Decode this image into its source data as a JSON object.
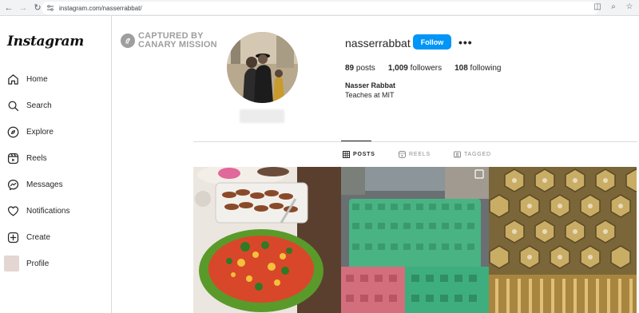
{
  "browser": {
    "url": "instagram.com/nasserrabbat/",
    "icons": [
      "back-arrow-icon",
      "forward-arrow-icon",
      "reload-icon",
      "site-info-icon",
      "cast-icon",
      "zoom-icon",
      "bookmark-star-icon"
    ]
  },
  "watermark": {
    "line1": "CAPTURED BY",
    "line2": "CANARY MISSION"
  },
  "sidebar": {
    "logo": "Instagram",
    "items": [
      {
        "label": "Home",
        "icon": "home-icon"
      },
      {
        "label": "Search",
        "icon": "search-icon"
      },
      {
        "label": "Explore",
        "icon": "compass-icon"
      },
      {
        "label": "Reels",
        "icon": "reels-icon"
      },
      {
        "label": "Messages",
        "icon": "messenger-icon"
      },
      {
        "label": "Notifications",
        "icon": "heart-icon"
      },
      {
        "label": "Create",
        "icon": "plus-square-icon"
      },
      {
        "label": "Profile",
        "icon": "avatar"
      }
    ]
  },
  "profile": {
    "username": "nasserrabbat",
    "follow_label": "Follow",
    "more_label": "•••",
    "posts_count": "89",
    "posts_label": " posts",
    "followers_count": "1,009",
    "followers_label": " followers",
    "following_count": "108",
    "following_label": " following",
    "full_name": "Nasser Rabbat",
    "bio": "Teaches at MIT"
  },
  "tabs": [
    {
      "label": "POSTS",
      "icon": "grid-icon",
      "active": true
    },
    {
      "label": "REELS",
      "icon": "reels-icon",
      "active": false
    },
    {
      "label": "TAGGED",
      "icon": "tagged-icon",
      "active": false
    }
  ],
  "colors": {
    "accent": "#0095f6",
    "text": "#262626",
    "border": "#dbdbdb",
    "muted": "#8e8e8e"
  }
}
